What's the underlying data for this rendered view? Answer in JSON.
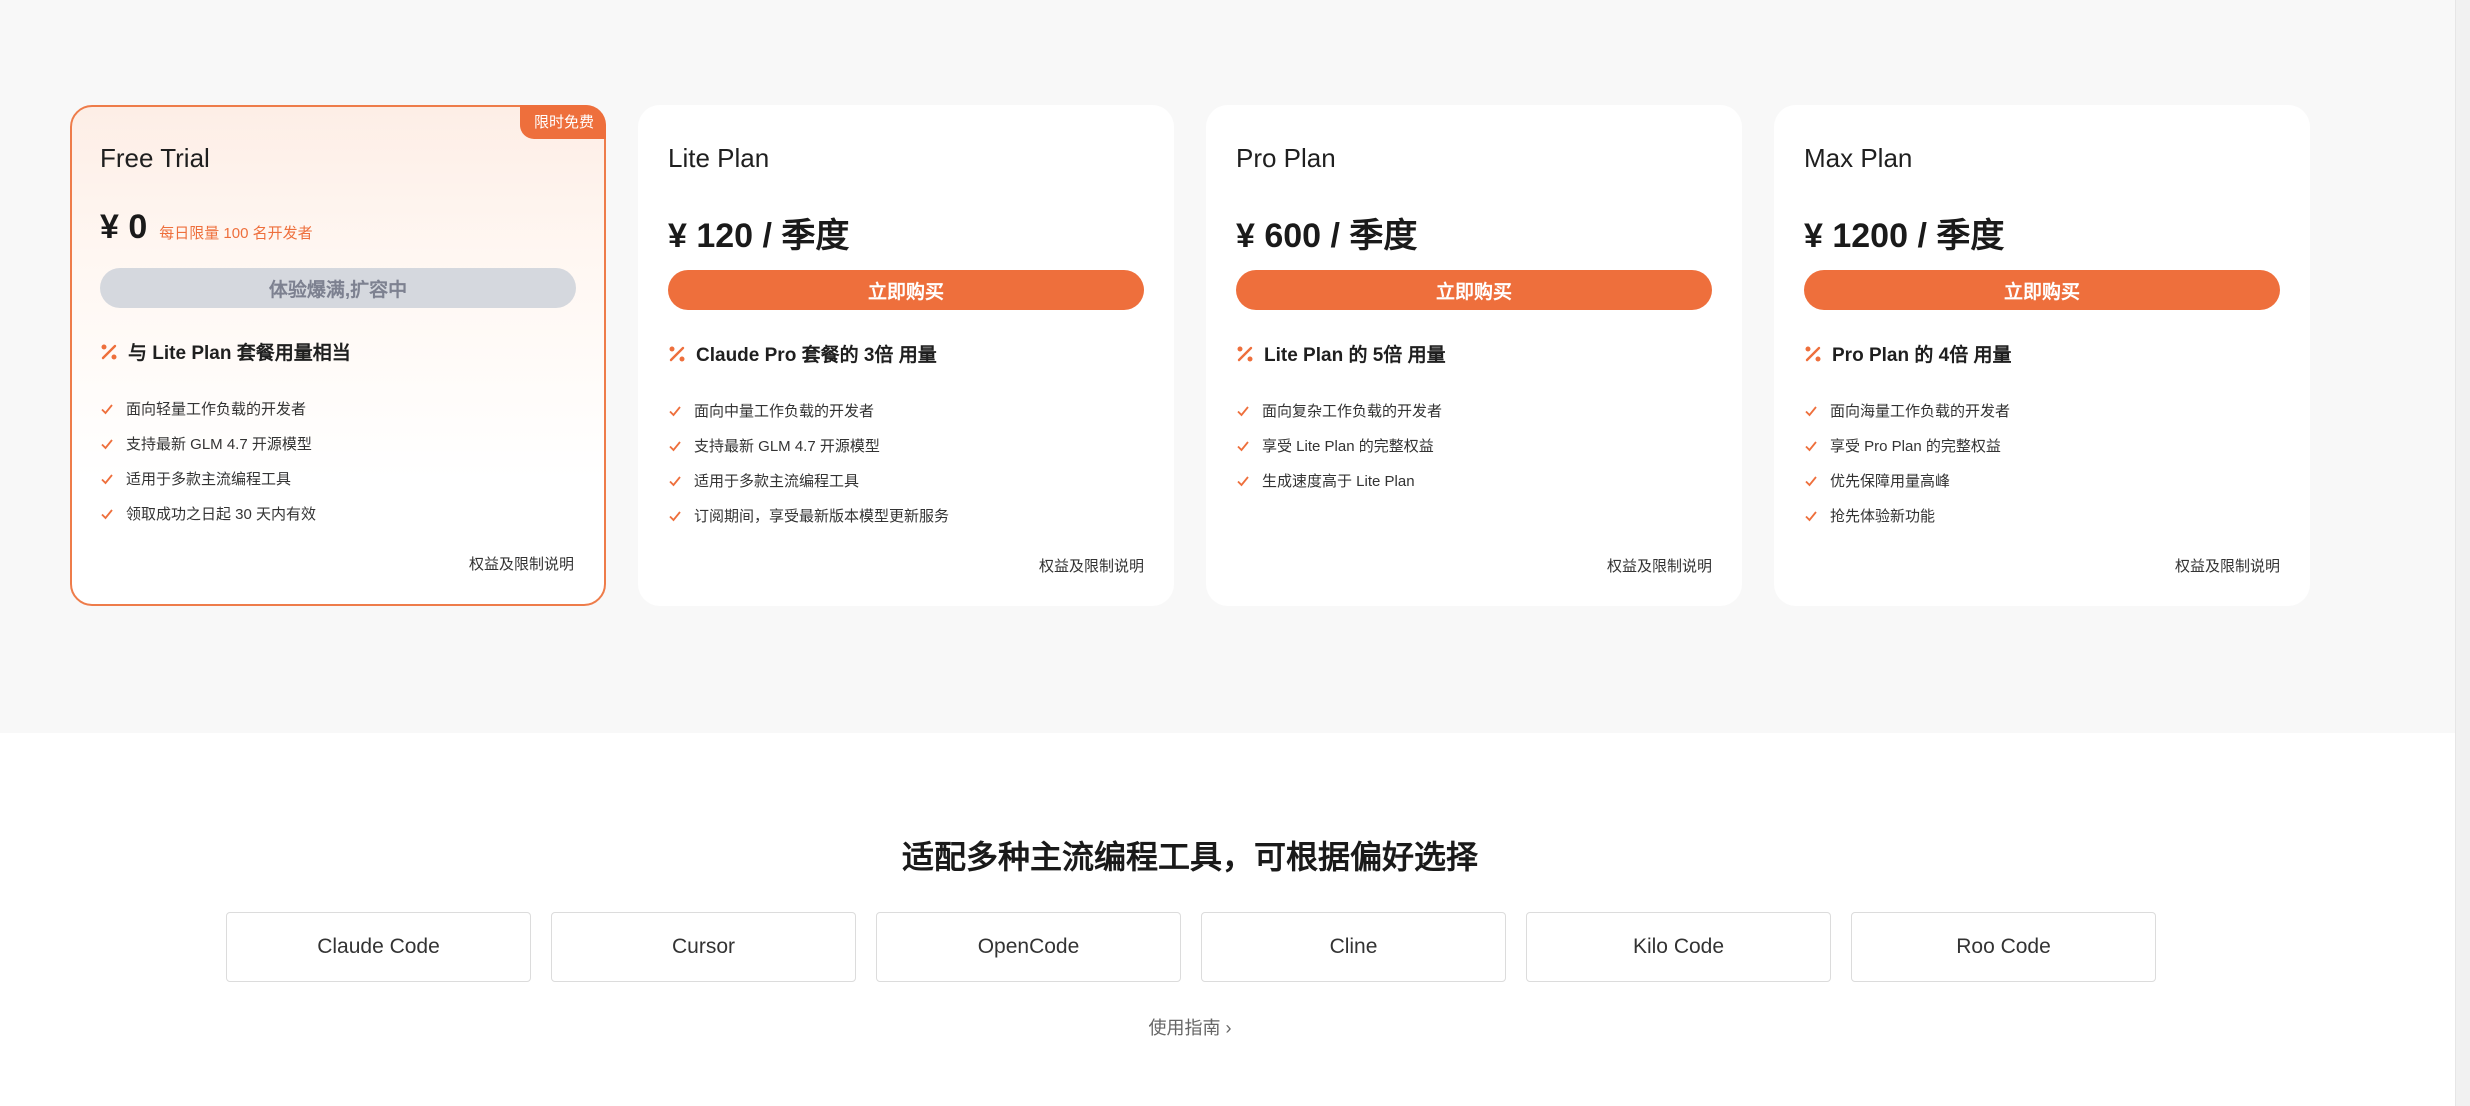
{
  "colors": {
    "accent": "#ee6f3c",
    "disabled_bg": "#d5d8de",
    "disabled_text": "#7d8190"
  },
  "plans": [
    {
      "name": "Free Trial",
      "badge": "限时免费",
      "price": "¥ 0",
      "price_note": "每日限量 100 名开发者",
      "cta": "体验爆满,扩容中",
      "highlight": "与 Lite Plan 套餐用量相当",
      "features": [
        "面向轻量工作负载的开发者",
        "支持最新 GLM 4.7 开源模型",
        "适用于多款主流编程工具",
        "领取成功之日起 30 天内有效"
      ],
      "terms": "权益及限制说明"
    },
    {
      "name": "Lite Plan",
      "price": "¥ 120 / 季度",
      "cta": "立即购买",
      "highlight": "Claude Pro 套餐的 3倍 用量",
      "features": [
        "面向中量工作负载的开发者",
        "支持最新 GLM 4.7 开源模型",
        "适用于多款主流编程工具",
        "订阅期间，享受最新版本模型更新服务"
      ],
      "terms": "权益及限制说明"
    },
    {
      "name": "Pro Plan",
      "price": "¥ 600 / 季度",
      "cta": "立即购买",
      "highlight": "Lite Plan 的 5倍 用量",
      "features": [
        "面向复杂工作负载的开发者",
        "享受 Lite Plan 的完整权益",
        "生成速度高于 Lite Plan"
      ],
      "terms": "权益及限制说明"
    },
    {
      "name": "Max Plan",
      "price": "¥ 1200 / 季度",
      "cta": "立即购买",
      "highlight": "Pro Plan 的 4倍 用量",
      "features": [
        "面向海量工作负载的开发者",
        "享受 Pro Plan 的完整权益",
        "优先保障用量高峰",
        "抢先体验新功能"
      ],
      "terms": "权益及限制说明"
    }
  ],
  "tools_section": {
    "title": "适配多种主流编程工具，可根据偏好选择",
    "tools": [
      "Claude Code",
      "Cursor",
      "OpenCode",
      "Cline",
      "Kilo Code",
      "Roo Code"
    ],
    "guide": "使用指南 ›"
  }
}
